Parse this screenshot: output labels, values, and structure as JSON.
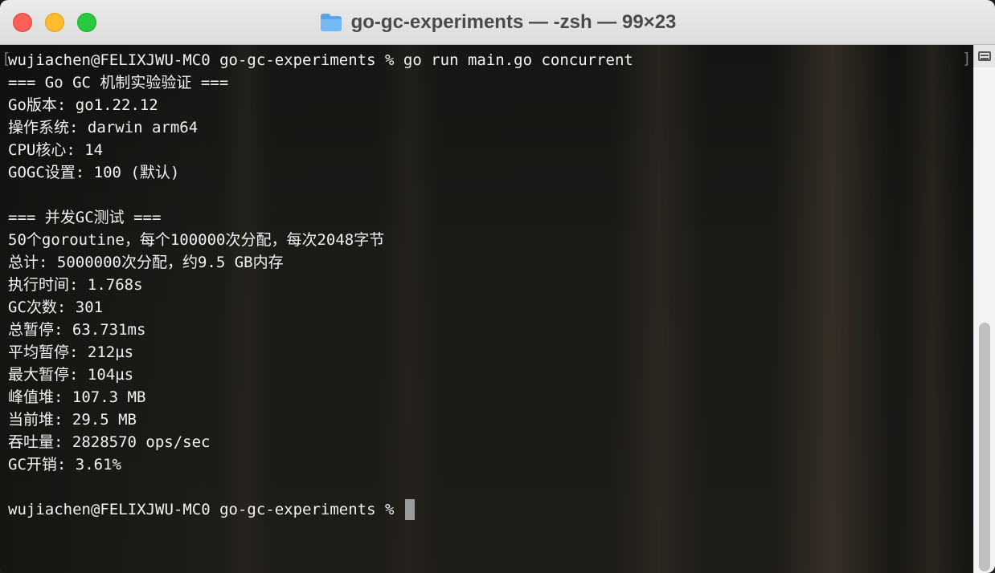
{
  "window": {
    "title": "go-gc-experiments — -zsh — 99×23",
    "folder_icon": "folder-icon"
  },
  "terminal": {
    "lines": [
      "wujiachen@FELIXJWU-MC0 go-gc-experiments % go run main.go concurrent",
      "=== Go GC 机制实验验证 ===",
      "Go版本: go1.22.12",
      "操作系统: darwin arm64",
      "CPU核心: 14",
      "GOGC设置: 100 (默认)",
      "",
      "=== 并发GC测试 ===",
      "50个goroutine，每个100000次分配，每次2048字节",
      "总计: 5000000次分配，约9.5 GB内存",
      "执行时间: 1.768s",
      "GC次数: 301",
      "总暂停: 63.731ms",
      "平均暂停: 212µs",
      "最大暂停: 104µs",
      "峰值堆: 107.3 MB",
      "当前堆: 29.5 MB",
      "吞吐量: 2828570 ops/sec",
      "GC开销: 3.61%",
      ""
    ],
    "prompt": "wujiachen@FELIXJWU-MC0 go-gc-experiments % ",
    "left_bracket": "[",
    "right_bracket": "]"
  },
  "colors": {
    "close": "#fe5f57",
    "minimize": "#febc2e",
    "zoom": "#28c840",
    "terminal_text": "#f2f2f2"
  }
}
